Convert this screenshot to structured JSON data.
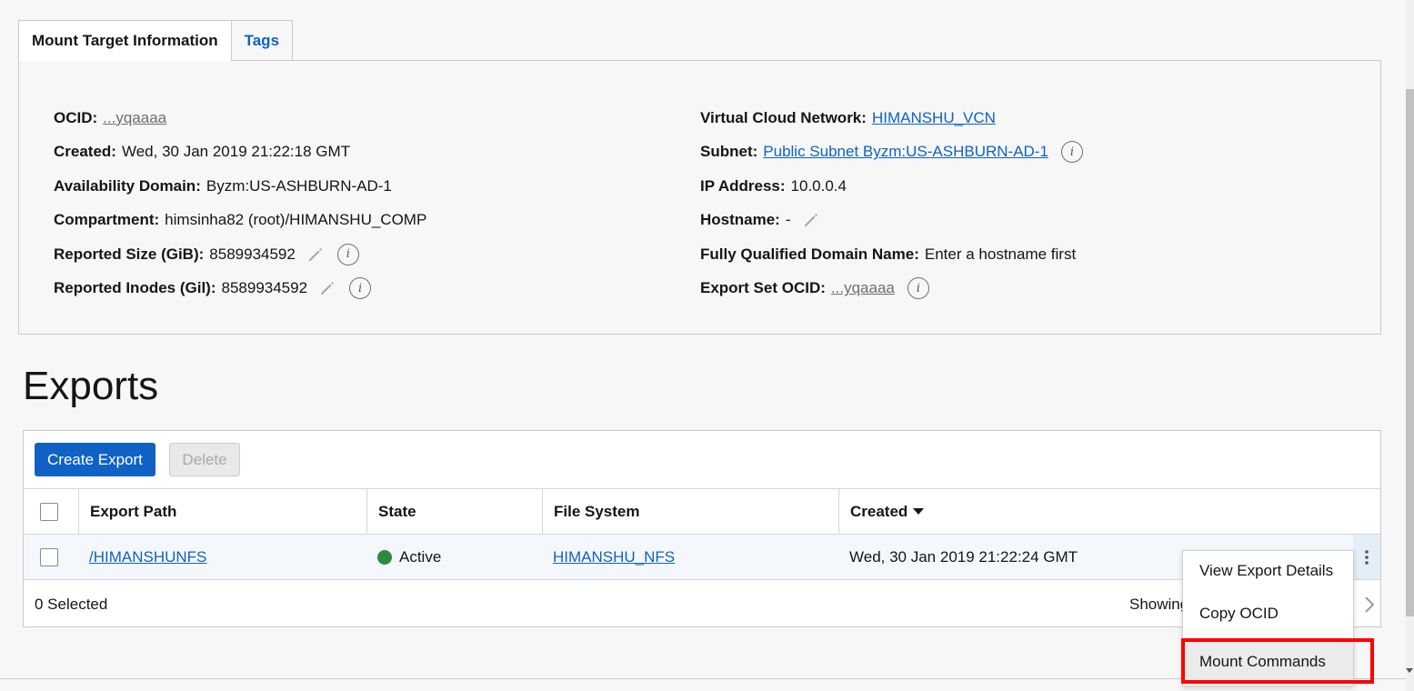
{
  "tabs": [
    {
      "label": "Mount Target Information"
    },
    {
      "label": "Tags"
    }
  ],
  "info": {
    "ocid_label": "OCID:",
    "ocid_value": "...yqaaaa",
    "created_label": "Created:",
    "created_value": "Wed, 30 Jan 2019 21:22:18 GMT",
    "ad_label": "Availability Domain:",
    "ad_value": "Byzm:US-ASHBURN-AD-1",
    "compartment_label": "Compartment:",
    "compartment_value": "himsinha82 (root)/HIMANSHU_COMP",
    "reported_size_label": "Reported Size (GiB):",
    "reported_size_value": "8589934592",
    "reported_inodes_label": "Reported Inodes (Gil):",
    "reported_inodes_value": "8589934592",
    "vcn_label": "Virtual Cloud Network:",
    "vcn_value": "HIMANSHU_VCN",
    "subnet_label": "Subnet:",
    "subnet_value": "Public Subnet Byzm:US-ASHBURN-AD-1",
    "ip_label": "IP Address:",
    "ip_value": "10.0.0.4",
    "hostname_label": "Hostname:",
    "hostname_value": "-",
    "fqdn_label": "Fully Qualified Domain Name:",
    "fqdn_value": "Enter a hostname first",
    "export_set_label": "Export Set OCID:",
    "export_set_value": "...yqaaaa",
    "info_glyph": "i"
  },
  "exports": {
    "title": "Exports",
    "create_button": "Create Export",
    "delete_button": "Delete",
    "columns": {
      "export_path": "Export Path",
      "state": "State",
      "file_system": "File System",
      "created": "Created"
    },
    "rows": [
      {
        "export_path": "/HIMANSHUNFS",
        "state": "Active",
        "file_system": "HIMANSHU_NFS",
        "created": "Wed, 30 Jan 2019 21:22:24 GMT"
      }
    ],
    "selected_count": "0 Selected",
    "showing_text": "Showing"
  },
  "context_menu": {
    "items": [
      "View Export Details",
      "Copy OCID",
      "Mount Commands"
    ]
  },
  "colors": {
    "accent": "#0f62c4",
    "active_status": "#2b8a3e",
    "highlight": "#ff0000"
  },
  "icons": {
    "edit": "pencil-icon",
    "info": "info-icon",
    "sort": "sort-desc-icon",
    "row_actions": "kebab-icon",
    "next_page": "chevron-right-icon"
  }
}
